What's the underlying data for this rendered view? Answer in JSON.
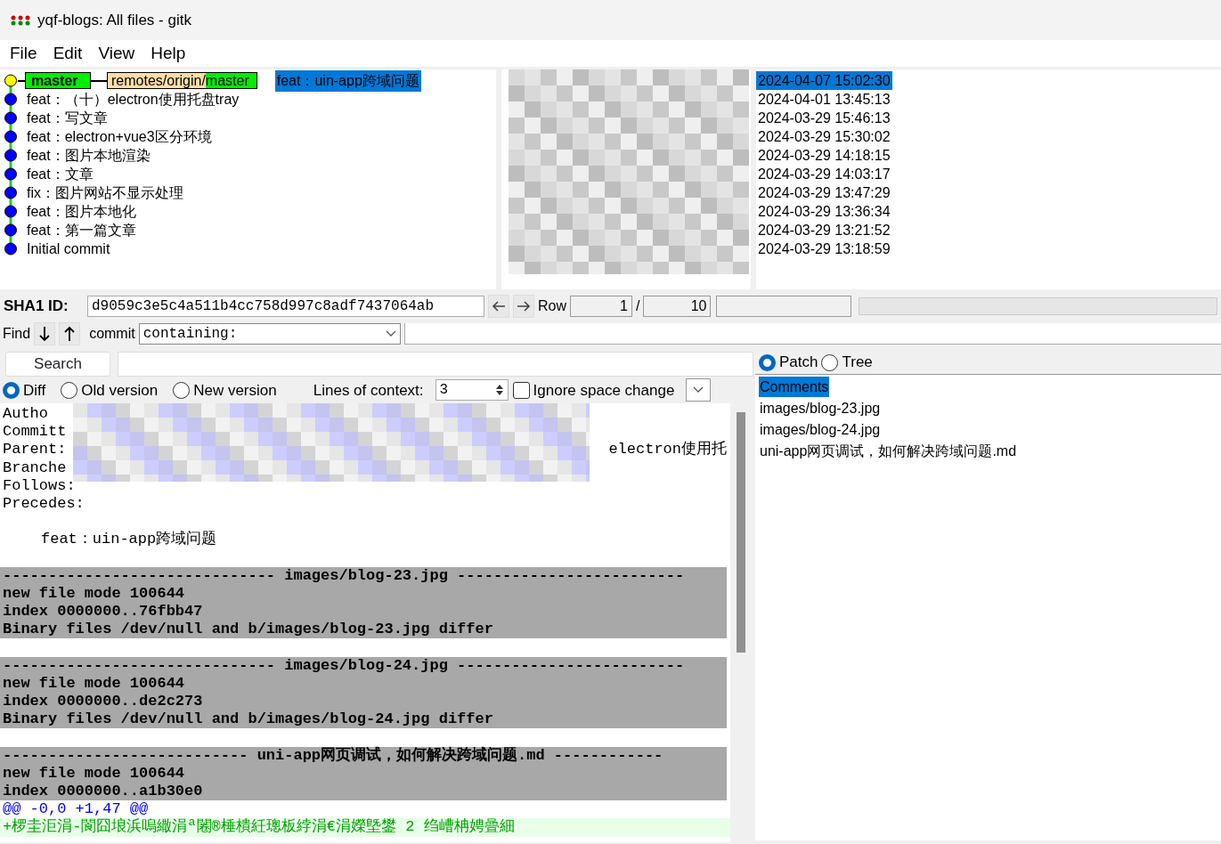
{
  "window": {
    "title": "yqf-blogs: All files - gitk"
  },
  "menu": [
    "File",
    "Edit",
    "View",
    "Help"
  ],
  "commits": [
    {
      "message": "feat：uin-app跨域问题",
      "date": "2024-04-07 15:02:30",
      "selected": true,
      "head": true,
      "refs": [
        {
          "kind": "local",
          "name": "master"
        },
        {
          "kind": "remote",
          "prefix": "remotes/origin/",
          "name": "master"
        }
      ]
    },
    {
      "message": "feat：（十）electron使用托盘tray",
      "date": "2024-04-01 13:45:13",
      "selected": false,
      "head": false
    },
    {
      "message": "feat：写文章",
      "date": "2024-03-29 15:46:13",
      "selected": false,
      "head": false
    },
    {
      "message": "feat：electron+vue3区分环境",
      "date": "2024-03-29 15:30:02",
      "selected": false,
      "head": false
    },
    {
      "message": "feat：图片本地渲染",
      "date": "2024-03-29 14:18:15",
      "selected": false,
      "head": false
    },
    {
      "message": "feat：文章",
      "date": "2024-03-29 14:03:17",
      "selected": false,
      "head": false
    },
    {
      "message": "fix：图片网站不显示处理",
      "date": "2024-03-29 13:47:29",
      "selected": false,
      "head": false
    },
    {
      "message": "feat：图片本地化",
      "date": "2024-03-29 13:36:34",
      "selected": false,
      "head": false
    },
    {
      "message": "feat：第一篇文章",
      "date": "2024-03-29 13:21:52",
      "selected": false,
      "head": false
    },
    {
      "message": "Initial commit",
      "date": "2024-03-29 13:18:59",
      "selected": false,
      "head": false
    }
  ],
  "sha1": {
    "label": "SHA1 ID:",
    "value": "d9059c3e5c4a511b4cc758d997c8adf7437064ab"
  },
  "row": {
    "label": "Row",
    "current": "1",
    "separator": "/",
    "total": "10"
  },
  "find": {
    "label": "Find",
    "type_label": "commit",
    "mode": "containing:"
  },
  "search_button": "Search",
  "diff_options": {
    "modes": [
      {
        "label": "Diff",
        "selected": true
      },
      {
        "label": "Old version",
        "selected": false
      },
      {
        "label": "New version",
        "selected": false
      }
    ],
    "context_label": "Lines of context:",
    "context_value": "3",
    "ignore_space": {
      "label": "Ignore space change",
      "checked": false
    }
  },
  "view_modes": [
    {
      "label": "Patch",
      "selected": true
    },
    {
      "label": "Tree",
      "selected": false
    }
  ],
  "files": [
    {
      "name": "Comments",
      "selected": true
    },
    {
      "name": "images/blog-23.jpg",
      "selected": false
    },
    {
      "name": "images/blog-24.jpg",
      "selected": false
    },
    {
      "name": "uni-app网页调试，如何解决跨域问题.md",
      "selected": false
    }
  ],
  "diff": {
    "header": [
      {
        "text": "Autho"
      },
      {
        "text": "Committ"
      },
      {
        "text": "Parent:",
        "tail": "electron使用托"
      },
      {
        "text": "Branche"
      },
      {
        "text": "Follows:"
      },
      {
        "text": "Precedes:"
      }
    ],
    "message": "feat：uin-app跨域问题",
    "sections": [
      {
        "lines": [
          {
            "kind": "file-header",
            "text": "------------------------------ images/blog-23.jpg -------------------------"
          },
          {
            "kind": "meta",
            "text": "new file mode 100644"
          },
          {
            "kind": "meta",
            "text": "index 0000000..76fbb47"
          },
          {
            "kind": "meta",
            "text": "Binary files /dev/null and b/images/blog-23.jpg differ"
          }
        ]
      },
      {
        "lines": [
          {
            "kind": "file-header",
            "text": "------------------------------ images/blog-24.jpg -------------------------"
          },
          {
            "kind": "meta",
            "text": "new file mode 100644"
          },
          {
            "kind": "meta",
            "text": "index 0000000..de2c273"
          },
          {
            "kind": "meta",
            "text": "Binary files /dev/null and b/images/blog-24.jpg differ"
          }
        ]
      },
      {
        "lines": [
          {
            "kind": "file-header",
            "text": "--------------------------- uni-app网页调试，如何解决跨域问题.md ------------"
          },
          {
            "kind": "meta",
            "text": "new file mode 100644"
          },
          {
            "kind": "meta",
            "text": "index 0000000..a1b30e0"
          },
          {
            "kind": "hunk",
            "text": "@@ -0,0 +1,47 @@"
          },
          {
            "kind": "added",
            "text": "+椤圭洰涓-閬囧埌浜嗚繖涓ª闂®棰樻紝璁板綍涓€涓嬫墍鐢 2 绉嶆柟娉曡細"
          }
        ]
      }
    ]
  }
}
